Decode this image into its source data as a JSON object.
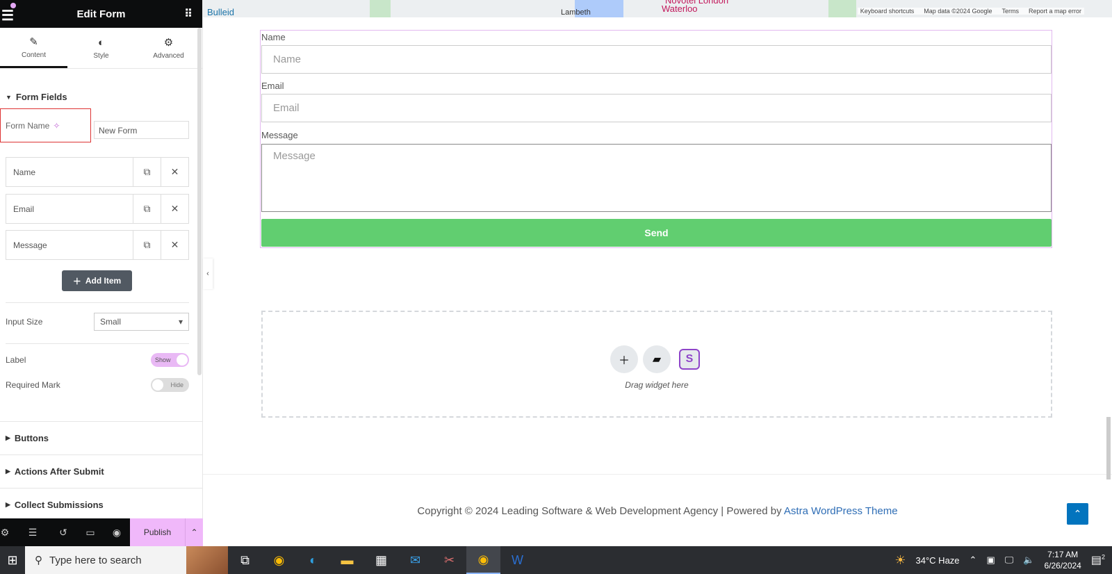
{
  "panel": {
    "title": "Edit Form",
    "tabs": [
      {
        "label": "Content",
        "icon": "pencil-icon",
        "active": true
      },
      {
        "label": "Style",
        "icon": "contrast-icon"
      },
      {
        "label": "Advanced",
        "icon": "gear-icon"
      }
    ],
    "section_form_fields": "Form Fields",
    "form_name_label": "Form Name",
    "form_name_value": "New Form",
    "fields": [
      {
        "label": "Name"
      },
      {
        "label": "Email"
      },
      {
        "label": "Message"
      }
    ],
    "add_item": "Add Item",
    "input_size_label": "Input Size",
    "input_size_value": "Small",
    "label_label": "Label",
    "label_toggle": "Show",
    "required_label": "Required Mark",
    "required_toggle": "Hide",
    "sections": [
      "Buttons",
      "Actions After Submit",
      "Collect Submissions"
    ],
    "publish": "Publish"
  },
  "map": {
    "labels": [
      "Bulleid",
      "Lambeth",
      "Novotel London",
      "Waterloo"
    ],
    "attribution": [
      "Keyboard shortcuts",
      "Map data ©2024 Google",
      "Terms",
      "Report a map error"
    ]
  },
  "form": {
    "name_label": "Name",
    "name_placeholder": "Name",
    "email_label": "Email",
    "email_placeholder": "Email",
    "message_label": "Message",
    "message_placeholder": "Message",
    "send": "Send"
  },
  "dropzone": {
    "text": "Drag widget here"
  },
  "footer": {
    "copyright": "Copyright © 2024 Leading Software & Web Development Agency | Powered by ",
    "link": "Astra WordPress Theme"
  },
  "taskbar": {
    "search_placeholder": "Type here to search",
    "weather": "34°C  Haze",
    "time": "7:17 AM",
    "date": "6/26/2024",
    "notifications": "2"
  },
  "colors": {
    "accent": "#f0b8fa",
    "send": "#61ce70",
    "link": "#2e6db5"
  }
}
